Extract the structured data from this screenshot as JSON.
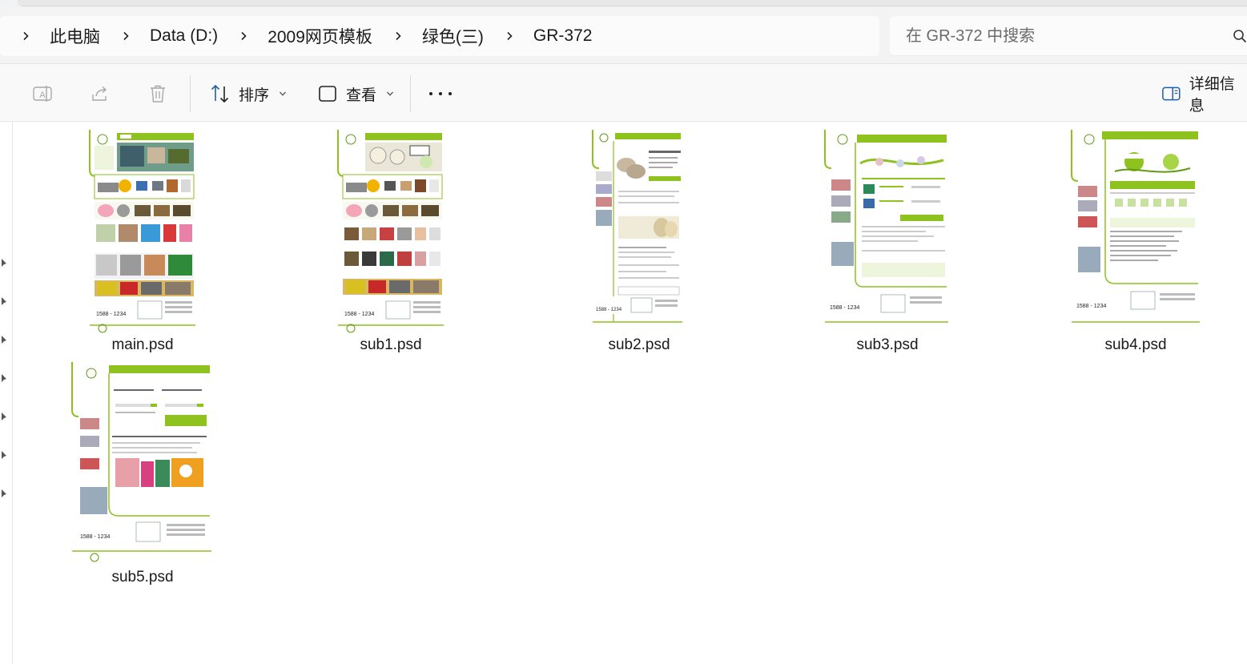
{
  "breadcrumb": {
    "items": [
      "此电脑",
      "Data (D:)",
      "2009网页模板",
      "绿色(三)",
      "GR-372"
    ]
  },
  "search": {
    "placeholder": "在 GR-372 中搜索"
  },
  "toolbar": {
    "sort_label": "排序",
    "view_label": "查看",
    "details_label": "详细信息"
  },
  "files": [
    {
      "name": "main.psd"
    },
    {
      "name": "sub1.psd"
    },
    {
      "name": "sub2.psd"
    },
    {
      "name": "sub3.psd"
    },
    {
      "name": "sub4.psd"
    },
    {
      "name": "sub5.psd"
    }
  ],
  "colors": {
    "accent_green": "#8dc21f",
    "dark_green": "#5f9a12"
  },
  "icons": [
    "chevron-right-icon",
    "search-icon",
    "rename-icon",
    "share-icon",
    "delete-icon",
    "sort-icon",
    "view-icon",
    "more-icon",
    "details-pane-icon",
    "pin-icon"
  ]
}
